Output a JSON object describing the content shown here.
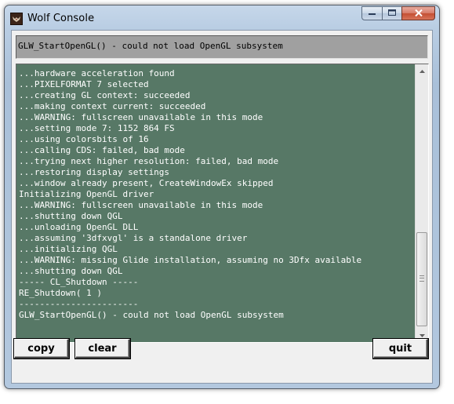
{
  "window": {
    "title": "Wolf Console",
    "app_icon": "wolf-icon",
    "caption_buttons": {
      "minimize": "minimize-icon",
      "maximize": "maximize-icon",
      "close": "close-icon"
    }
  },
  "error_line": "GLW_StartOpenGL() - could not load OpenGL subsystem",
  "console": {
    "background_color": "#577866",
    "text_color": "#ffffff",
    "lines": [
      "...hardware acceleration found",
      "...PIXELFORMAT 7 selected",
      "...creating GL context: succeeded",
      "...making context current: succeeded",
      "...WARNING: fullscreen unavailable in this mode",
      "...setting mode 7: 1152 864 FS",
      "...using colorsbits of 16",
      "...calling CDS: failed, bad mode",
      "...trying next higher resolution: failed, bad mode",
      "...restoring display settings",
      "...window already present, CreateWindowEx skipped",
      "Initializing OpenGL driver",
      "...WARNING: fullscreen unavailable in this mode",
      "...shutting down QGL",
      "...unloading OpenGL DLL",
      "...assuming '3dfxvgl' is a standalone driver",
      "...initializing QGL",
      "...WARNING: missing Glide installation, assuming no 3Dfx available",
      "...shutting down QGL",
      "----- CL_Shutdown -----",
      "RE_Shutdown( 1 )",
      "-----------------------",
      "GLW_StartOpenGL() - could not load OpenGL subsystem"
    ]
  },
  "buttons": {
    "copy": "copy",
    "clear": "clear",
    "quit": "quit"
  }
}
